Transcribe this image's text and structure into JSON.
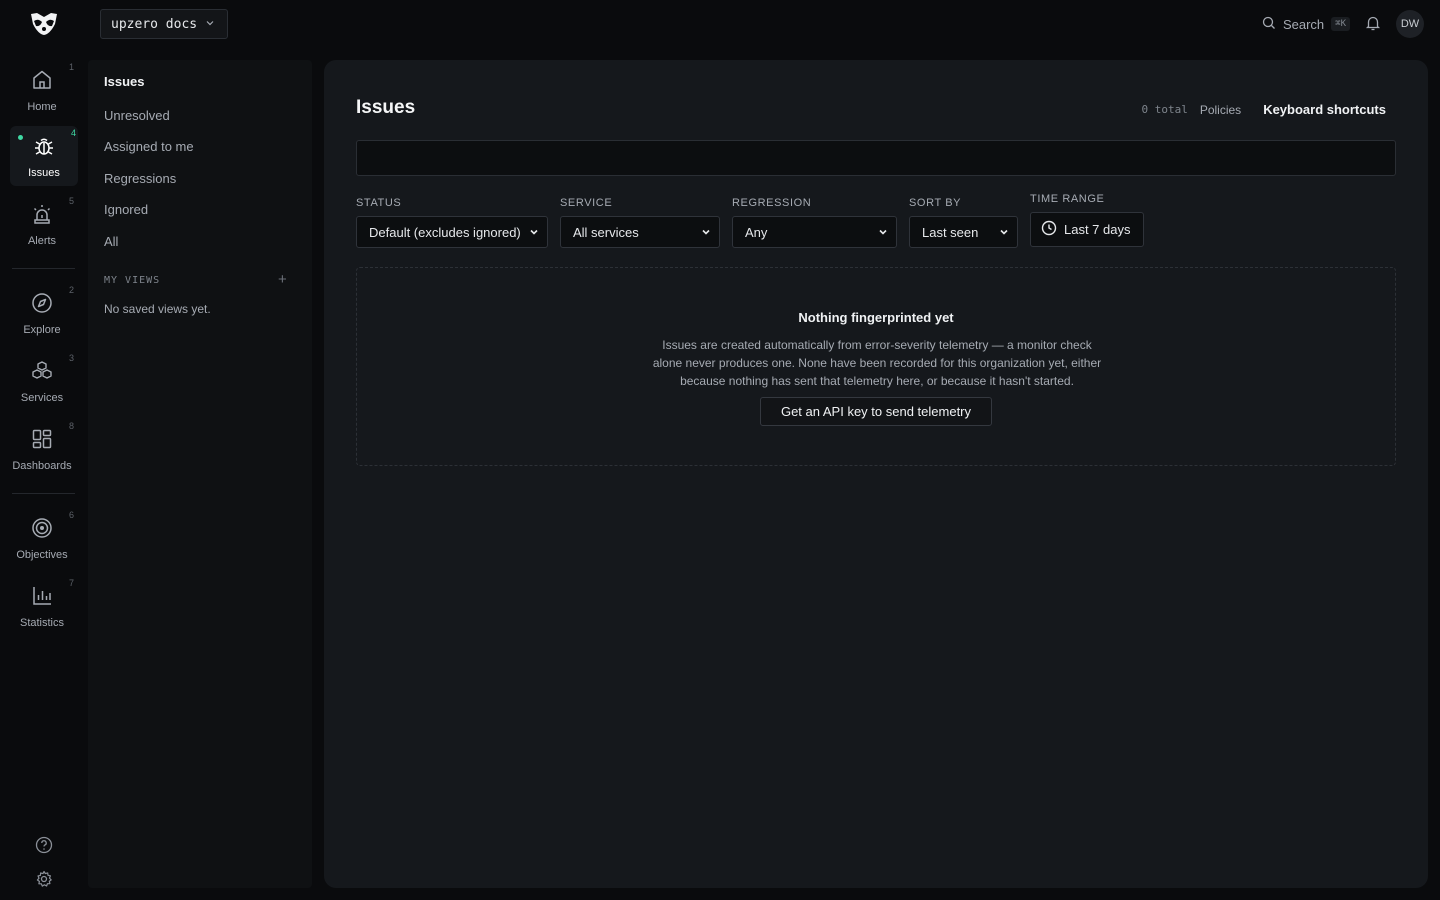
{
  "topbar": {
    "org_name": "upzero docs",
    "search_label": "Search",
    "search_shortcut": "⌘K",
    "avatar_initials": "DW"
  },
  "rail": {
    "items": [
      {
        "label": "Home",
        "num": "1",
        "icon": "home-icon",
        "active": false
      },
      {
        "label": "Issues",
        "num": "4",
        "icon": "bug-icon",
        "active": true
      },
      {
        "label": "Alerts",
        "num": "5",
        "icon": "siren-icon",
        "active": false
      },
      {
        "label": "Explore",
        "num": "2",
        "icon": "compass-icon",
        "active": false
      },
      {
        "label": "Services",
        "num": "3",
        "icon": "boxes-icon",
        "active": false
      },
      {
        "label": "Dashboards",
        "num": "8",
        "icon": "dashboard-grid-icon",
        "active": false
      },
      {
        "label": "Objectives",
        "num": "6",
        "icon": "target-icon",
        "active": false
      },
      {
        "label": "Statistics",
        "num": "7",
        "icon": "bar-chart-icon",
        "active": false
      }
    ],
    "footer": [
      "help-icon",
      "gear-icon"
    ],
    "accent_color": "#3fd8a3"
  },
  "subnav": {
    "title": "Issues",
    "items": [
      "Unresolved",
      "Assigned to me",
      "Regressions",
      "Ignored",
      "All"
    ],
    "views_label": "MY VIEWS",
    "views_add": "+",
    "views_empty": "No saved views yet."
  },
  "main": {
    "title": "Issues",
    "total": "0 total",
    "policies": "Policies",
    "shortcuts": "Keyboard shortcuts",
    "search_value": "",
    "filters": {
      "status": {
        "label": "STATUS",
        "value": "Default (excludes ignored)"
      },
      "service": {
        "label": "SERVICE",
        "value": "All services"
      },
      "regression": {
        "label": "REGRESSION",
        "value": "Any"
      },
      "sort": {
        "label": "SORT BY",
        "value": "Last seen"
      },
      "time": {
        "label": "TIME RANGE",
        "value": "Last 7 days"
      }
    },
    "empty": {
      "title": "Nothing fingerprinted yet",
      "text": "Issues are created automatically from error-severity telemetry — a monitor check alone never produces one. None have been recorded for this organization yet, either because nothing has sent that telemetry here, or because it hasn't started.",
      "cta": "Get an API key to send telemetry"
    }
  }
}
